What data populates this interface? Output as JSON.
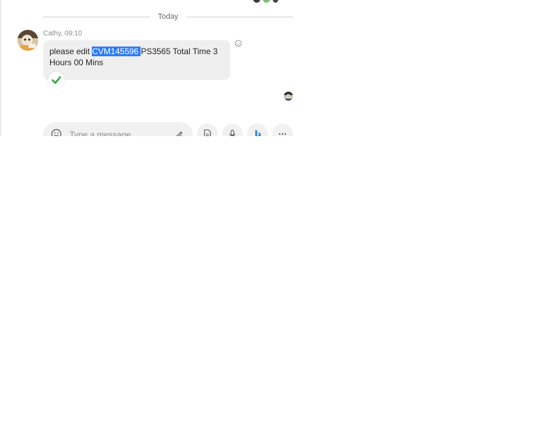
{
  "divider": {
    "label": "Today"
  },
  "message": {
    "sender": "Cathy",
    "time": "09:10",
    "meta": "Cathy, 09:10",
    "text_before": "please edit ",
    "text_selected": "CVM145596 ",
    "text_after": " PS3565  Total Time 3 Hours 00 Mins"
  },
  "composer": {
    "placeholder": "Type a message"
  },
  "colors": {
    "selection": "#2e7cf6",
    "bubble": "#efefef",
    "check": "#22a53a",
    "bing": "#1b7fd6"
  },
  "icons": {
    "emoji": "smiley-icon",
    "react": "add-reaction-icon",
    "seen": "checkmark-icon",
    "sketch": "pen-icon",
    "file": "file-icon",
    "mic": "microphone-icon",
    "bing": "bing-icon",
    "more": "more-icon"
  }
}
